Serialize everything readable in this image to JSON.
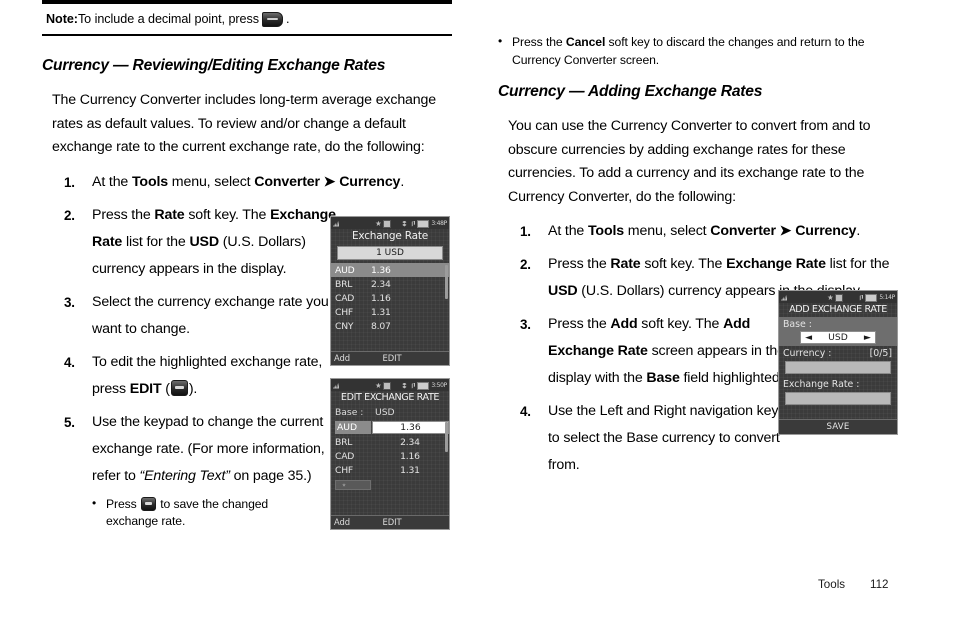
{
  "note": {
    "label": "Note:",
    "text_before": " To include a decimal point, press ",
    "icon": "keypad-star-key-icon",
    "text_after": " ."
  },
  "left_column": {
    "section_title": "Currency — Reviewing/Editing Exchange Rates",
    "intro": "The Currency Converter includes long-term average exchange rates as default values. To review and/or change a default exchange rate to the current exchange rate, do the following:",
    "steps": [
      {
        "num": "1.",
        "text": "At the Tools menu, select Converter ➔ Currency."
      },
      {
        "num": "2.",
        "text": "Press the Rate soft key. The Exchange Rate list for the USD (U.S. Dollars) currency appears in the display."
      },
      {
        "num": "3.",
        "text": "Select the currency exchange rate you want to change."
      },
      {
        "num": "4.",
        "text": "To edit the highlighted exchange rate, press EDIT ( )."
      },
      {
        "num": "5.",
        "text": "Use the keypad to change the current exchange rate. (For more information, refer to “Entering Text” on page 35.)"
      }
    ],
    "sub_bullet": "Press  to save the changed exchange rate."
  },
  "right_column": {
    "top_bullet": "Press the Cancel soft key to discard the changes and return to the Currency Converter screen.",
    "section_title": "Currency — Adding Exchange Rates",
    "intro": "You can use the Currency Converter to convert from and to obscure currencies by adding exchange rates for these currencies. To add a currency and its exchange rate to the Currency Converter, do the following:",
    "steps": [
      {
        "num": "1.",
        "text": "At the Tools menu, select Converter ➔ Currency."
      },
      {
        "num": "2.",
        "text": "Press the Rate soft key. The Exchange Rate list for the USD (U.S. Dollars) currency appears in the display."
      },
      {
        "num": "3.",
        "text": "Press the Add soft key. The Add Exchange Rate screen appears in the display with the Base field highlighted."
      },
      {
        "num": "4.",
        "text": "Use the Left and Right navigation keys to select the Base currency to convert from."
      }
    ]
  },
  "phone_screen_1": {
    "status_time": "3:48P",
    "title": "Exchange Rate",
    "base_bar": "1 USD",
    "rows": [
      {
        "code": "AUD",
        "value": "1.36",
        "selected": true
      },
      {
        "code": "BRL",
        "value": "2.34",
        "selected": false
      },
      {
        "code": "CAD",
        "value": "1.16",
        "selected": false
      },
      {
        "code": "CHF",
        "value": "1.31",
        "selected": false
      },
      {
        "code": "CNY",
        "value": "8.07",
        "selected": false
      }
    ],
    "softkey_left": "Add",
    "softkey_mid": "EDIT"
  },
  "phone_screen_2": {
    "status_time": "3:50P",
    "title": "EDIT EXCHANGE RATE",
    "base_label": "Base :",
    "base_value": "USD",
    "edit_row": {
      "code": "AUD",
      "value": "1.36"
    },
    "rows": [
      {
        "code": "BRL",
        "value": "2.34"
      },
      {
        "code": "CAD",
        "value": "1.16"
      },
      {
        "code": "CHF",
        "value": "1.31"
      }
    ],
    "softkey_left": "Add",
    "softkey_mid": "EDIT"
  },
  "phone_screen_3": {
    "status_time": "5:14P",
    "title": "ADD EXCHANGE RATE",
    "base_label": "Base :",
    "base_value": "USD",
    "arrow_left": "◄",
    "arrow_right": "►",
    "currency_label": "Currency :",
    "currency_count": "[0/5]",
    "rate_label": "Exchange Rate :",
    "softkey_save": "SAVE"
  },
  "footer": {
    "label": "Tools",
    "page": "112"
  }
}
